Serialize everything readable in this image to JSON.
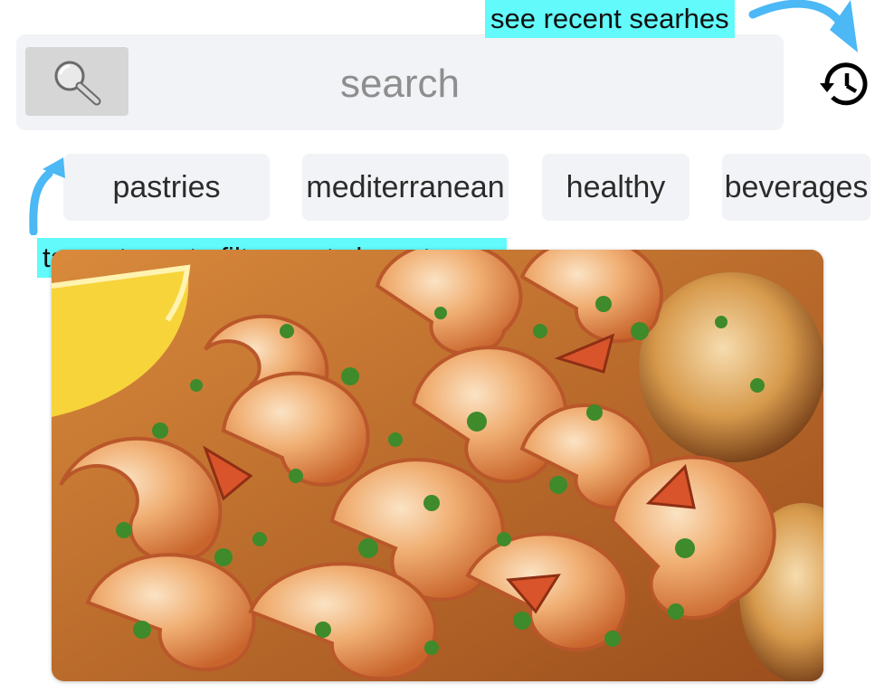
{
  "search": {
    "placeholder": "search"
  },
  "annotations": {
    "recent_searches": "see recent searhes",
    "category_tip": "tap catgory to filter posts by category"
  },
  "categories": [
    {
      "label": "pastries"
    },
    {
      "label": "mediterranean"
    },
    {
      "label": "healthy"
    },
    {
      "label": "beverages"
    }
  ],
  "colors": {
    "callout_bg": "#62fafa",
    "arrow": "#4cb8f5",
    "chip_bg": "#f2f3f6",
    "search_bg": "#f2f3f6"
  },
  "icons": {
    "search_button": "magnifier-icon",
    "history": "history-icon"
  }
}
